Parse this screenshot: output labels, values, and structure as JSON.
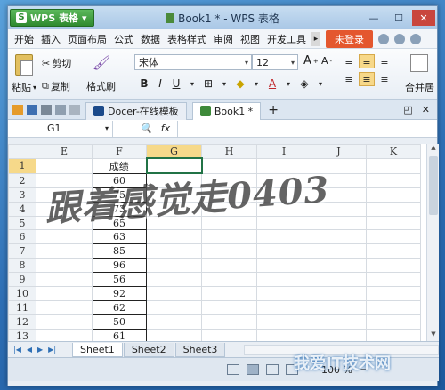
{
  "window": {
    "app_button": "WPS 表格",
    "app_logo": "S",
    "title": "Book1 * - WPS 表格"
  },
  "menu": {
    "items": [
      "开始",
      "插入",
      "页面布局",
      "公式",
      "数据",
      "表格样式",
      "审阅",
      "视图",
      "开发工具"
    ],
    "login": "未登录"
  },
  "ribbon": {
    "paste": "粘贴",
    "cut": "剪切",
    "copy": "复制",
    "format_painter": "格式刷",
    "font_name": "宋体",
    "font_size": "12",
    "bold": "B",
    "italic": "I",
    "underline": "U",
    "merge": "合并居"
  },
  "tabs": [
    {
      "label": "Docer-在线模板"
    },
    {
      "label": "Book1 *"
    }
  ],
  "formula_bar": {
    "cell_ref": "G1",
    "fx": "fx"
  },
  "grid": {
    "columns": [
      "E",
      "F",
      "G",
      "H",
      "I",
      "J",
      "K"
    ],
    "rows": [
      {
        "num": "1",
        "f": "成绩"
      },
      {
        "num": "2",
        "f": "60"
      },
      {
        "num": "3",
        "f": "75"
      },
      {
        "num": "4",
        "f": "73"
      },
      {
        "num": "5",
        "f": "65"
      },
      {
        "num": "6",
        "f": "63"
      },
      {
        "num": "7",
        "f": "85"
      },
      {
        "num": "8",
        "f": "96"
      },
      {
        "num": "9",
        "f": "56"
      },
      {
        "num": "10",
        "f": "92"
      },
      {
        "num": "11",
        "f": "62"
      },
      {
        "num": "12",
        "f": "50"
      },
      {
        "num": "13",
        "f": "61"
      }
    ],
    "selected_cell": "G1"
  },
  "sheets": [
    "Sheet1",
    "Sheet2",
    "Sheet3"
  ],
  "status": {
    "zoom": "100 %"
  },
  "watermark": "跟着感觉走0403",
  "site_watermark": "我爱IT技术网",
  "colors": {
    "accent_green": "#217346",
    "login_orange": "#e4572e",
    "selected_header": "#f6d98a"
  }
}
